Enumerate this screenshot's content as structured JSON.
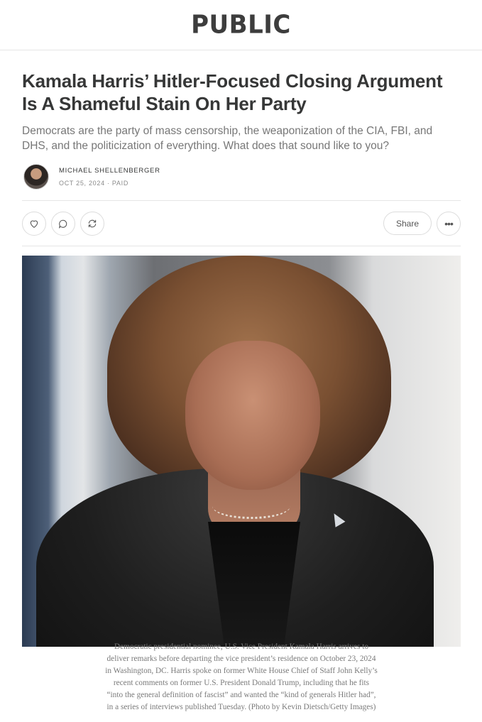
{
  "header": {
    "logo": "PUBLIC"
  },
  "article": {
    "title": "Kamala Harris’ Hitler-Focused Closing Argument Is A Shameful Stain On Her Party",
    "subtitle": "Democrats are the party of mass censorship, the weaponization of the CIA, FBI, and DHS, and the politicization of everything. What does that sound like to you?",
    "author": "MICHAEL SHELLENBERGER",
    "date": "OCT 25, 2024",
    "separator": "·",
    "access": "PAID"
  },
  "actions": {
    "like_icon": "heart-icon",
    "comment_icon": "comment-icon",
    "restack_icon": "restack-icon",
    "share_label": "Share",
    "more_label": "•••"
  },
  "photo": {
    "caption_lines": [
      "Democratic presidential nominee, U.S. Vice President Kamala Harris arrives to",
      "deliver remarks before departing the vice president’s residence on October 23, 2024",
      "in Washington, DC. Harris spoke on former White House Chief of Staff John Kelly’s",
      "recent comments on former U.S. President Donald Trump, including that he fits",
      "“into the general definition of fascist” and wanted the “kind of generals Hitler had”,",
      "in a series of interviews published Tuesday. (Photo by Kevin Dietsch/Getty Images)"
    ]
  },
  "colors": {
    "text": "#363737",
    "muted": "#777777",
    "border": "#e6e6e6"
  }
}
